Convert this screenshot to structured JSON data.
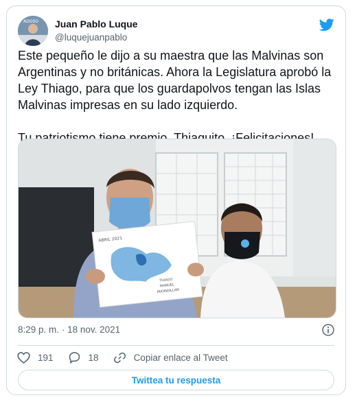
{
  "author": {
    "name": "Juan Pablo Luque",
    "handle": "@luquejuanpablo",
    "avatar_badge": "ADOSO"
  },
  "tweet": {
    "text_paragraph_1": "Este pequeño le dijo a su maestra que las Malvinas son Argentinas y no británicas. Ahora la Legislatura aprobó la Ley Thiago, para que los guardapolvos tengan las Islas Malvinas impresas en su lado izquierdo.",
    "text_paragraph_2": "Tu patriotismo tiene premio, Thiaguito. ¡Felicitaciones!",
    "drawing_caption_top": "ABRIL 2021",
    "drawing_caption_bottom_1": "THIAGO",
    "drawing_caption_bottom_2": "MANUEL",
    "drawing_caption_bottom_3": "IRIONDILLAN"
  },
  "meta": {
    "time": "8:29 p. m.",
    "separator": "·",
    "date": "18 nov. 2021"
  },
  "actions": {
    "likes": "191",
    "replies": "18",
    "copy_link": "Copiar enlace al Tweet"
  },
  "reply_button": "Twittea tu respuesta",
  "colors": {
    "accent": "#1d9bf0",
    "text": "#0f1419",
    "secondary": "#536471",
    "border": "#cfd9de"
  },
  "icons": [
    "twitter-bird-icon",
    "info-icon",
    "heart-icon",
    "reply-icon",
    "link-icon"
  ]
}
